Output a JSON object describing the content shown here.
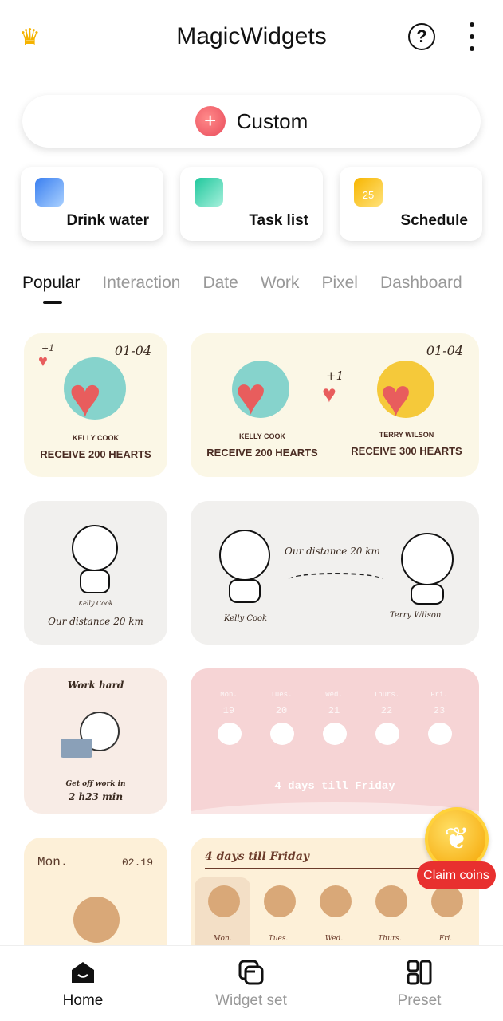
{
  "header": {
    "title": "MagicWidgets",
    "crown_icon": "crown-icon",
    "help_icon": "help-circle-icon",
    "more_icon": "more-vertical-icon"
  },
  "custom": {
    "label": "Custom",
    "icon": "plus-icon"
  },
  "quick_actions": [
    {
      "label": "Drink water",
      "icon": "water-icon",
      "color": "#4a8cf0"
    },
    {
      "label": "Task list",
      "icon": "list-icon",
      "color": "#2cc9a5"
    },
    {
      "label": "Schedule",
      "icon": "calendar-icon",
      "color": "#f7c325",
      "day": "25"
    }
  ],
  "tabs": [
    {
      "label": "Popular",
      "active": true
    },
    {
      "label": "Interaction"
    },
    {
      "label": "Date"
    },
    {
      "label": "Work"
    },
    {
      "label": "Pixel"
    },
    {
      "label": "Dashboard"
    }
  ],
  "widgets": {
    "hearts_small": {
      "plus": "+1",
      "date": "01-04",
      "name": "KELLY COOK",
      "caption": "RECEIVE 200 HEARTS"
    },
    "hearts_large": {
      "date": "01-04",
      "plus": "+1",
      "left_name": "KELLY COOK",
      "left_caption": "RECEIVE 200 HEARTS",
      "right_name": "TERRY WILSON",
      "right_caption": "RECEIVE 300 HEARTS"
    },
    "distance_small": {
      "name": "Kelly Cook",
      "caption": "Our distance 20 km"
    },
    "distance_large": {
      "caption": "Our distance 20 km",
      "left_name": "Kelly Cook",
      "right_name": "Terry Wilson"
    },
    "work_small": {
      "title": "Work hard",
      "line1": "Get off work in",
      "line2": "2 h23 min"
    },
    "week_pink": {
      "days": [
        {
          "d": "Mon.",
          "n": "19"
        },
        {
          "d": "Tues.",
          "n": "20"
        },
        {
          "d": "Wed.",
          "n": "21"
        },
        {
          "d": "Thurs.",
          "n": "22"
        },
        {
          "d": "Fri.",
          "n": "23"
        }
      ],
      "caption": "4 days till Friday"
    },
    "date_small": {
      "day": "Mon.",
      "date": "02.19"
    },
    "week_bear": {
      "title": "4 days till Friday",
      "days": [
        "Mon.",
        "Tues.",
        "Wed.",
        "Thurs.",
        "Fri."
      ]
    }
  },
  "claim": {
    "label": "Claim coins",
    "icon": "leaf-coin-icon"
  },
  "bottom_nav": [
    {
      "label": "Home",
      "icon": "home-icon",
      "active": true
    },
    {
      "label": "Widget set",
      "icon": "widget-set-icon"
    },
    {
      "label": "Preset",
      "icon": "preset-grid-icon"
    }
  ]
}
